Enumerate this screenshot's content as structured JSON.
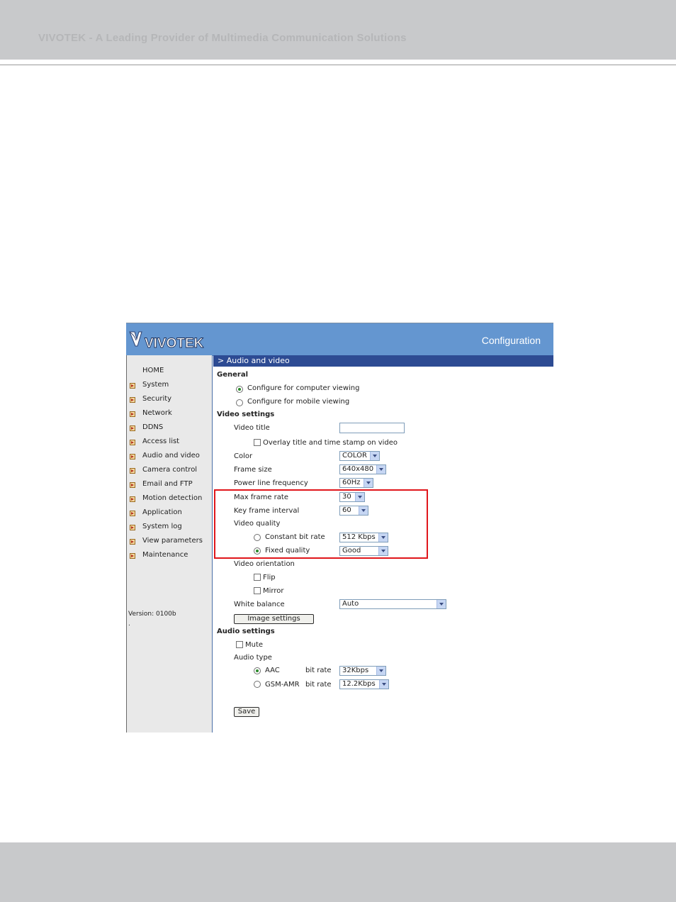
{
  "page_header": {
    "title": "VIVOTEK - A Leading Provider of Multimedia Communication Solutions"
  },
  "app": {
    "logo_text": "VIVOTEK",
    "title": "Configuration",
    "section": "> Audio and video"
  },
  "nav": {
    "items": [
      {
        "label": "HOME",
        "bullet": false
      },
      {
        "label": "System",
        "bullet": true
      },
      {
        "label": "Security",
        "bullet": true
      },
      {
        "label": "Network",
        "bullet": true
      },
      {
        "label": "DDNS",
        "bullet": true
      },
      {
        "label": "Access list",
        "bullet": true
      },
      {
        "label": "Audio and video",
        "bullet": true
      },
      {
        "label": "Camera control",
        "bullet": true
      },
      {
        "label": "Email and FTP",
        "bullet": true
      },
      {
        "label": "Motion detection",
        "bullet": true
      },
      {
        "label": "Application",
        "bullet": true
      },
      {
        "label": "System log",
        "bullet": true
      },
      {
        "label": "View parameters",
        "bullet": true
      },
      {
        "label": "Maintenance",
        "bullet": true
      }
    ],
    "version": "Version: 0100b",
    "version_dot": "."
  },
  "general": {
    "heading": "General",
    "opt_computer": "Configure for computer viewing",
    "opt_mobile": "Configure for mobile viewing",
    "selected": "computer"
  },
  "video": {
    "heading": "Video settings",
    "title_label": "Video title",
    "title_value": "",
    "overlay_label": "Overlay title and time stamp on video",
    "color_label": "Color",
    "color_value": "COLOR",
    "frame_size_label": "Frame size",
    "frame_size_value": "640x480",
    "power_label": "Power line frequency",
    "power_value": "60Hz",
    "max_rate_label": "Max frame rate",
    "max_rate_value": "30",
    "key_interval_label": "Key frame interval",
    "key_interval_value": "60",
    "quality_label": "Video quality",
    "cbr_label": "Constant bit rate",
    "cbr_value": "512 Kbps",
    "fixed_label": "Fixed quality",
    "fixed_value": "Good",
    "quality_selected": "fixed",
    "orientation_label": "Video orientation",
    "flip_label": "Flip",
    "mirror_label": "Mirror",
    "wb_label": "White balance",
    "wb_value": "Auto",
    "image_settings_button": "Image settings"
  },
  "audio": {
    "heading": "Audio settings",
    "mute_label": "Mute",
    "type_label": "Audio type",
    "aac_label": "AAC",
    "aac_bitrate_label": "bit rate",
    "aac_bitrate_value": "32Kbps",
    "gsm_label": "GSM-AMR",
    "gsm_bitrate_label": "bit rate",
    "gsm_bitrate_value": "12.2Kbps",
    "selected": "aac"
  },
  "save_button": "Save",
  "colors": {
    "topbar": "#6496d0",
    "section_bar": "#2d4b93",
    "highlight": "#e0161b",
    "page_band": "#c8c9cb"
  }
}
